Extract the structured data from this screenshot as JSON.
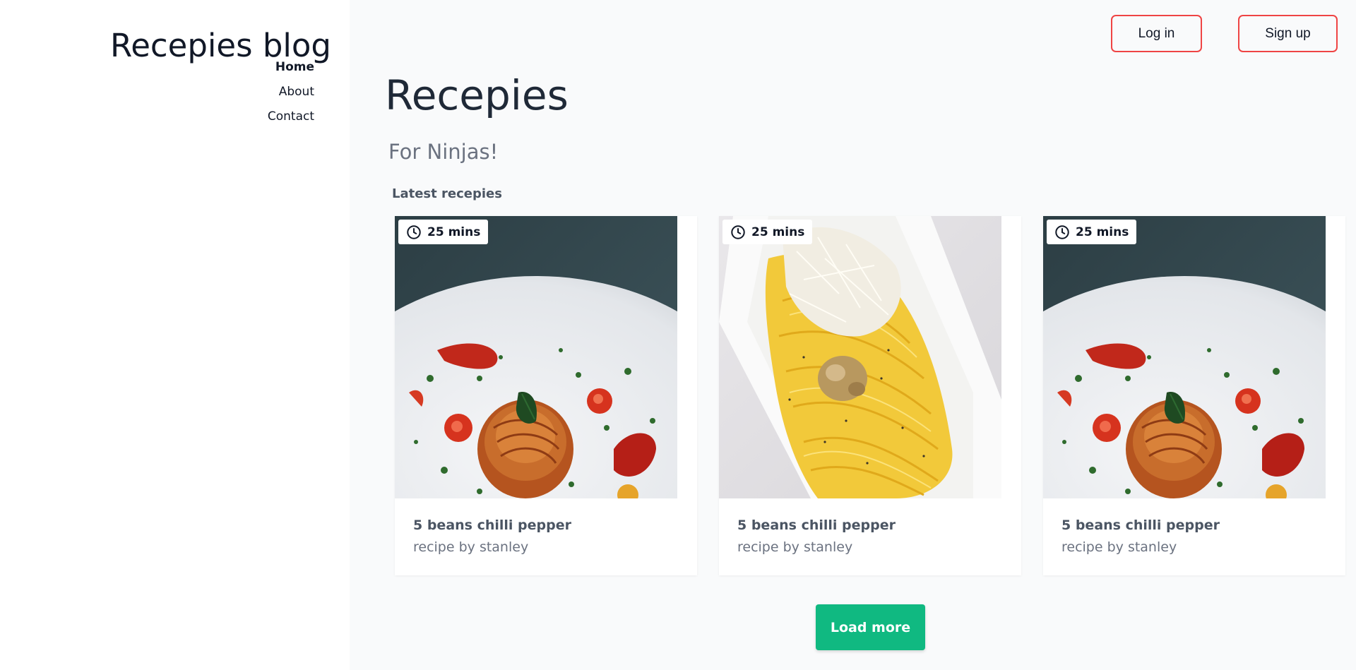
{
  "sidebar": {
    "brand": "Recepies blog",
    "nav": [
      {
        "label": "Home",
        "active": true
      },
      {
        "label": "About",
        "active": false
      },
      {
        "label": "Contact",
        "active": false
      }
    ]
  },
  "header": {
    "login_label": "Log in",
    "signup_label": "Sign up"
  },
  "main": {
    "title": "Recepies",
    "subtitle": "For Ninjas!",
    "section_label": "Latest recepies",
    "cards": [
      {
        "time": "25 mins",
        "title": "5 beans chilli pepper",
        "author": "recipe by stanley",
        "image": "spaghetti-nest-plate"
      },
      {
        "time": "25 mins",
        "title": "5 beans chilli pepper",
        "author": "recipe by stanley",
        "image": "pasta-cheese-plate"
      },
      {
        "time": "25 mins",
        "title": "5 beans chilli pepper",
        "author": "recipe by stanley",
        "image": "spaghetti-nest-plate"
      }
    ],
    "load_more_label": "Load more"
  },
  "colors": {
    "accent_border": "#ef4444",
    "primary_button": "#10b981",
    "background": "#f9fafb",
    "sidebar_bg": "#ffffff"
  }
}
